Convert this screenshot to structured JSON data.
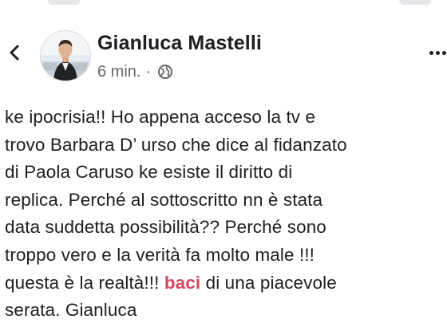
{
  "author": {
    "name": "Gianluca Mastelli",
    "avatar_icon": "profile-photo"
  },
  "meta": {
    "time": "6 min.",
    "separator": "·",
    "audience_icon": "globe-icon"
  },
  "navigation": {
    "back_icon": "chevron-left-icon",
    "more_icon": "more-horizontal-icon"
  },
  "post": {
    "lines": [
      "ke ipocrisia!! Ho appena acceso la tv e",
      "trovo Barbara D’ urso che dice al fidanzato",
      "di Paola Caruso ke esiste il diritto di",
      "replica. Perché al sottoscritto nn è stata",
      "data suddetta possibilità?? Perché sono",
      "troppo vero e la verità fa molto male !!!",
      {
        "before": "questa è la realtà!!! ",
        "highlight": "baci",
        "after": " di una piacevole"
      },
      "serata.  Gianluca"
    ]
  },
  "colors": {
    "text": "#1c1e21",
    "meta": "#65676b",
    "highlight": "#d6455e",
    "background": "#ffffff"
  }
}
